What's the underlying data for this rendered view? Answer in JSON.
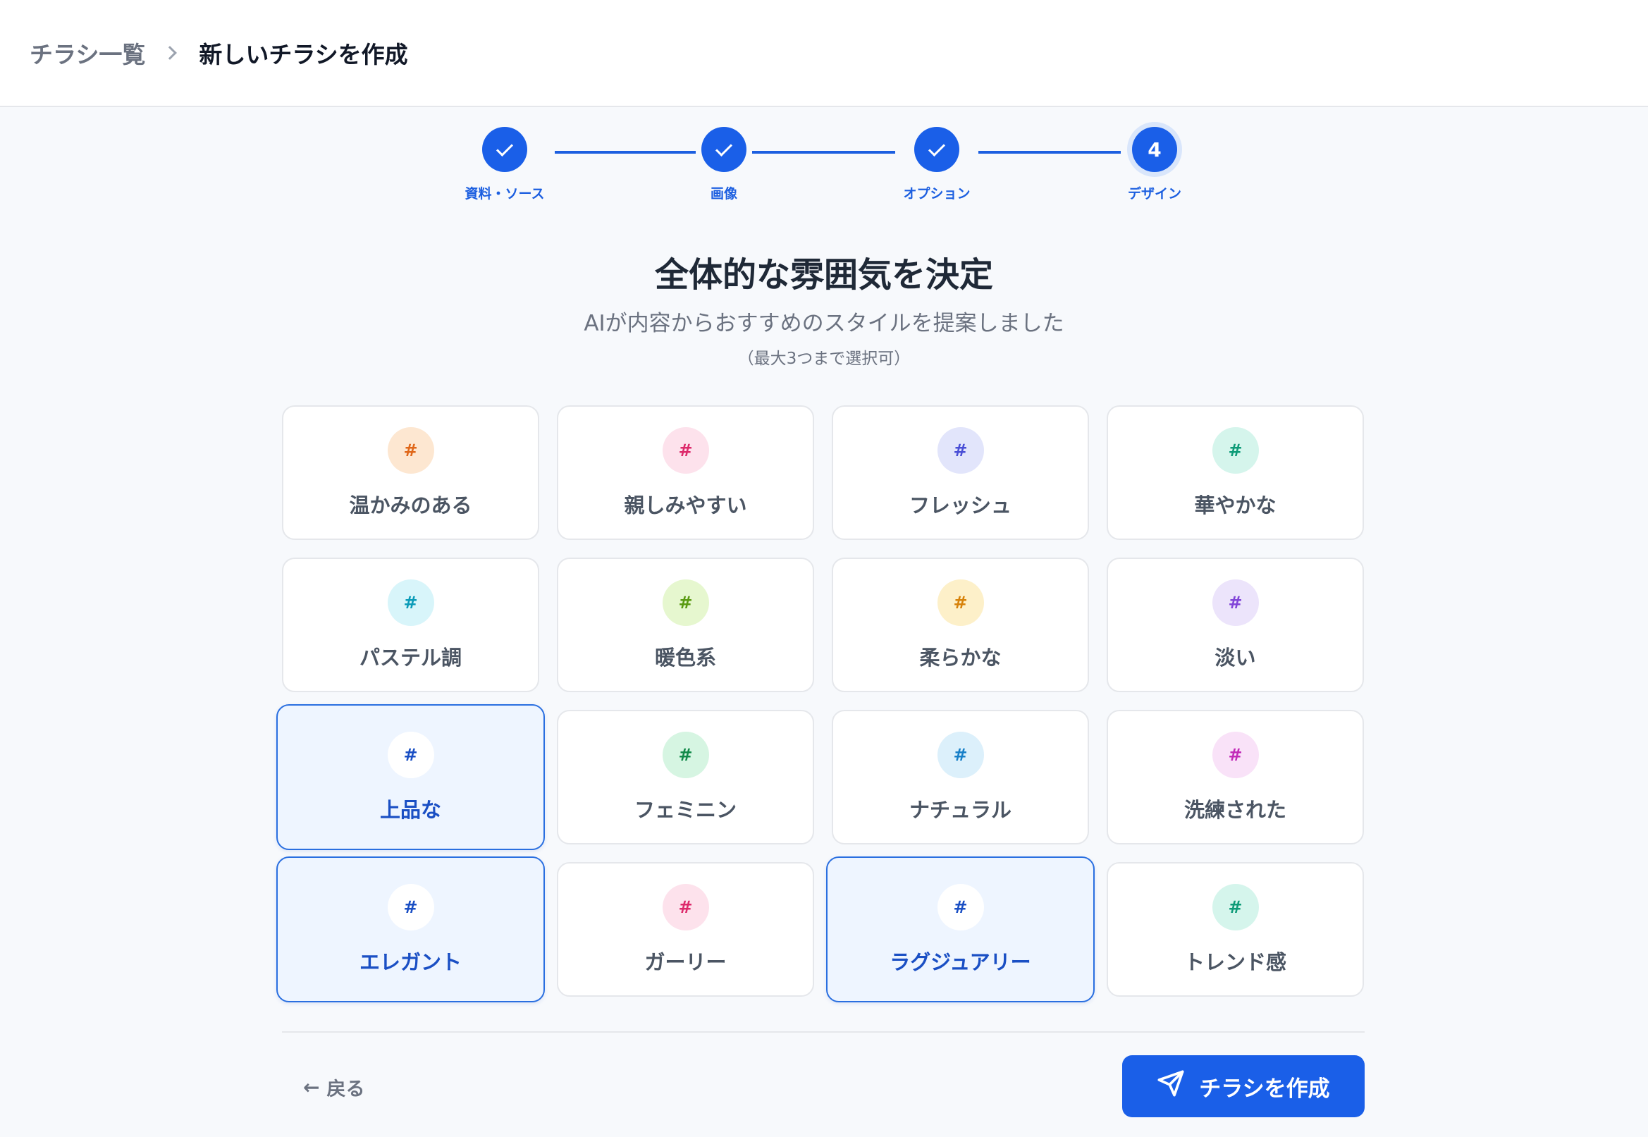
{
  "breadcrumb": {
    "root": "チラシ一覧",
    "current": "新しいチラシを作成"
  },
  "stepper": {
    "steps": [
      {
        "label": "資料・ソース",
        "state": "done"
      },
      {
        "label": "画像",
        "state": "done"
      },
      {
        "label": "オプション",
        "state": "done"
      },
      {
        "label": "デザイン",
        "state": "current",
        "number": "4"
      }
    ]
  },
  "heading": {
    "title": "全体的な雰囲気を決定",
    "subtitle": "AIが内容からおすすめのスタイルを提案しました",
    "note": "（最大3つまで選択可）"
  },
  "styles": {
    "hash_symbol": "#",
    "items": [
      {
        "label": "温かみのある",
        "icon_bg": "#fde7d1",
        "icon_color": "#e0681a",
        "selected": false
      },
      {
        "label": "親しみやすい",
        "icon_bg": "#fde2ec",
        "icon_color": "#dd2a6b",
        "selected": false
      },
      {
        "label": "フレッシュ",
        "icon_bg": "#e2e5fb",
        "icon_color": "#4a4fd6",
        "selected": false
      },
      {
        "label": "華やかな",
        "icon_bg": "#d5f5ec",
        "icon_color": "#0e9b78",
        "selected": false
      },
      {
        "label": "パステル調",
        "icon_bg": "#d8f5fa",
        "icon_color": "#0a9bb8",
        "selected": false
      },
      {
        "label": "暖色系",
        "icon_bg": "#e6f7cf",
        "icon_color": "#5a9a12",
        "selected": false
      },
      {
        "label": "柔らかな",
        "icon_bg": "#fdf0c9",
        "icon_color": "#d7820a",
        "selected": false
      },
      {
        "label": "淡い",
        "icon_bg": "#ece4fb",
        "icon_color": "#8144d8",
        "selected": false
      },
      {
        "label": "上品な",
        "icon_bg": "#ffffff",
        "icon_color": "#1a4fc4",
        "selected": true
      },
      {
        "label": "フェミニン",
        "icon_bg": "#d6f5e2",
        "icon_color": "#138a4a",
        "selected": false
      },
      {
        "label": "ナチュラル",
        "icon_bg": "#dcf0fb",
        "icon_color": "#1880c8",
        "selected": false
      },
      {
        "label": "洗練された",
        "icon_bg": "#f9e2f8",
        "icon_color": "#c22ab8",
        "selected": false
      },
      {
        "label": "エレガント",
        "icon_bg": "#ffffff",
        "icon_color": "#1a4fc4",
        "selected": true
      },
      {
        "label": "ガーリー",
        "icon_bg": "#fde2ec",
        "icon_color": "#dd2a6b",
        "selected": false
      },
      {
        "label": "ラグジュアリー",
        "icon_bg": "#ffffff",
        "icon_color": "#1a4fc4",
        "selected": true
      },
      {
        "label": "トレンド感",
        "icon_bg": "#d5f5ec",
        "icon_color": "#0e9b78",
        "selected": false
      }
    ]
  },
  "footer": {
    "back_arrow": "←",
    "back_label": "戻る",
    "create_label": "チラシを作成"
  },
  "colors": {
    "accent": "#1a5fe8",
    "selected_bg": "#eef5ff",
    "selected_border": "#2a6fe0"
  }
}
